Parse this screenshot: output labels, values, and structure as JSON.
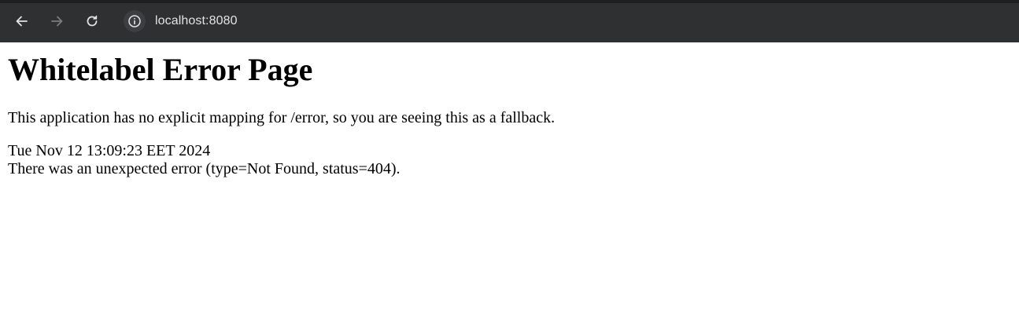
{
  "browser": {
    "url": "localhost:8080",
    "icons": {
      "back": "arrow-left-icon",
      "forward": "arrow-right-icon",
      "reload": "reload-icon",
      "site_info": "info-icon"
    },
    "colors": {
      "toolbar_bg": "#2f3032",
      "icon_active": "#e3e3e3",
      "icon_disabled": "#7b7c7e",
      "url_text": "#e3e3e3"
    }
  },
  "page": {
    "title": "Whitelabel Error Page",
    "message": "This application has no explicit mapping for /error, so you are seeing this as a fallback.",
    "timestamp": "Tue Nov 12 13:09:23 EET 2024",
    "error": "There was an unexpected error (type=Not Found, status=404)."
  }
}
